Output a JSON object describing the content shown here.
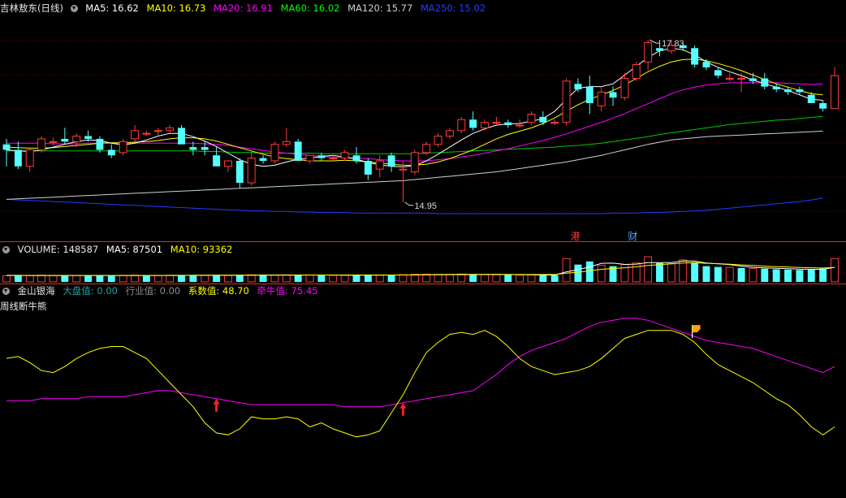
{
  "header": {
    "stock_name": "吉林敖东(日线)",
    "ma": [
      {
        "label": "MA5: 16.62",
        "color": "#ffffff"
      },
      {
        "label": "MA10: 16.73",
        "color": "#ffff00"
      },
      {
        "label": "MA20: 16.91",
        "color": "#ff00ff"
      },
      {
        "label": "MA60: 16.02",
        "color": "#00ff00"
      },
      {
        "label": "MA120: 15.77",
        "color": "#d0d0d0"
      },
      {
        "label": "MA250: 15.02",
        "color": "#1f3fff"
      }
    ]
  },
  "price_markers": {
    "high": "17.83",
    "low": "14.95",
    "tag1": "港",
    "tag2": "财"
  },
  "volume_legend": {
    "title": "VOLUME: 148587",
    "ma5": "MA5: 87501",
    "ma10": "MA10: 93362"
  },
  "indicator_legend": {
    "name": "金山银海",
    "dapan": "大盘值: 0.00",
    "hangye": "行业值: 0.00",
    "xishu": "系数值: 48.70",
    "qianniu": "牵牛值: 75.45",
    "subtitle": "周线断牛熊"
  },
  "colors": {
    "up": "#ff3b3b",
    "down": "#54ffff",
    "grid": "#7a0000",
    "separator": "#c0392b"
  },
  "chart_data": {
    "type": "candlestick",
    "ylim": [
      14.4,
      18.3
    ],
    "candles": [
      [
        16.0,
        16.1,
        15.6,
        15.9
      ],
      [
        15.9,
        16.05,
        15.55,
        15.6
      ],
      [
        15.6,
        15.95,
        15.5,
        15.9
      ],
      [
        15.9,
        16.15,
        15.85,
        16.1
      ],
      [
        16.05,
        16.12,
        15.98,
        16.05
      ],
      [
        16.1,
        16.3,
        16.0,
        16.05
      ],
      [
        16.05,
        16.2,
        15.95,
        16.15
      ],
      [
        16.15,
        16.25,
        16.05,
        16.1
      ],
      [
        16.1,
        16.15,
        15.85,
        15.9
      ],
      [
        15.9,
        16.0,
        15.75,
        15.8
      ],
      [
        15.85,
        16.1,
        15.8,
        16.05
      ],
      [
        16.1,
        16.35,
        16.05,
        16.25
      ],
      [
        16.2,
        16.25,
        16.15,
        16.2
      ],
      [
        16.25,
        16.3,
        16.15,
        16.25
      ],
      [
        16.25,
        16.35,
        16.2,
        16.3
      ],
      [
        16.3,
        16.35,
        16.0,
        16.0
      ],
      [
        15.95,
        16.05,
        15.8,
        15.9
      ],
      [
        15.95,
        16.05,
        15.8,
        15.9
      ],
      [
        15.8,
        15.95,
        15.6,
        15.6
      ],
      [
        15.6,
        15.7,
        15.5,
        15.7
      ],
      [
        15.7,
        15.75,
        15.2,
        15.3
      ],
      [
        15.3,
        15.9,
        15.25,
        15.75
      ],
      [
        15.75,
        15.8,
        15.65,
        15.7
      ],
      [
        15.7,
        16.05,
        15.65,
        16.0
      ],
      [
        16.0,
        16.3,
        15.95,
        16.05
      ],
      [
        16.05,
        16.1,
        15.7,
        15.7
      ],
      [
        15.7,
        15.8,
        15.65,
        15.8
      ],
      [
        15.8,
        15.85,
        15.7,
        15.75
      ],
      [
        15.75,
        15.8,
        15.7,
        15.75
      ],
      [
        15.75,
        15.9,
        15.7,
        15.85
      ],
      [
        15.8,
        15.95,
        15.65,
        15.7
      ],
      [
        15.7,
        15.75,
        15.35,
        15.45
      ],
      [
        15.55,
        15.8,
        15.4,
        15.7
      ],
      [
        15.8,
        15.85,
        15.5,
        15.6
      ],
      [
        15.55,
        15.7,
        14.95,
        15.55
      ],
      [
        15.5,
        15.9,
        15.45,
        15.85
      ],
      [
        15.85,
        16.05,
        15.8,
        16.0
      ],
      [
        16.0,
        16.2,
        15.95,
        16.15
      ],
      [
        16.15,
        16.3,
        16.1,
        16.25
      ],
      [
        16.25,
        16.5,
        16.2,
        16.45
      ],
      [
        16.45,
        16.6,
        16.25,
        16.3
      ],
      [
        16.3,
        16.45,
        16.25,
        16.4
      ],
      [
        16.4,
        16.5,
        16.35,
        16.4
      ],
      [
        16.4,
        16.45,
        16.3,
        16.35
      ],
      [
        16.35,
        16.45,
        16.3,
        16.35
      ],
      [
        16.4,
        16.6,
        16.35,
        16.55
      ],
      [
        16.5,
        16.6,
        16.35,
        16.4
      ],
      [
        16.4,
        16.45,
        16.35,
        16.4
      ],
      [
        16.4,
        17.2,
        16.35,
        17.15
      ],
      [
        17.1,
        17.2,
        16.95,
        17.0
      ],
      [
        17.05,
        17.25,
        16.55,
        16.75
      ],
      [
        16.7,
        17.05,
        16.6,
        16.95
      ],
      [
        16.95,
        17.05,
        16.7,
        16.85
      ],
      [
        16.85,
        17.3,
        16.8,
        17.2
      ],
      [
        17.2,
        17.5,
        17.15,
        17.45
      ],
      [
        17.5,
        17.9,
        17.35,
        17.85
      ],
      [
        17.75,
        17.9,
        17.6,
        17.7
      ],
      [
        17.7,
        17.9,
        17.65,
        17.8
      ],
      [
        17.8,
        17.83,
        17.7,
        17.75
      ],
      [
        17.75,
        17.8,
        17.4,
        17.45
      ],
      [
        17.5,
        17.55,
        17.35,
        17.4
      ],
      [
        17.35,
        17.4,
        17.2,
        17.25
      ],
      [
        17.2,
        17.3,
        17.15,
        17.2
      ],
      [
        17.2,
        17.3,
        16.95,
        17.2
      ],
      [
        17.2,
        17.3,
        17.1,
        17.15
      ],
      [
        17.2,
        17.3,
        17.0,
        17.05
      ],
      [
        17.05,
        17.1,
        16.95,
        17.0
      ],
      [
        17.0,
        17.05,
        16.9,
        16.95
      ],
      [
        17.0,
        17.05,
        16.9,
        16.95
      ],
      [
        16.9,
        16.95,
        16.75,
        16.75
      ],
      [
        16.75,
        16.8,
        16.6,
        16.65
      ],
      [
        16.65,
        17.4,
        16.7,
        17.25
      ]
    ],
    "ma5": [
      15.9,
      15.88,
      15.87,
      15.9,
      15.95,
      16.0,
      16.05,
      16.08,
      16.07,
      16.02,
      15.99,
      16.02,
      16.08,
      16.15,
      16.2,
      16.2,
      16.14,
      16.06,
      15.96,
      15.84,
      15.72,
      15.64,
      15.6,
      15.62,
      15.68,
      15.73,
      15.75,
      15.78,
      15.8,
      15.77,
      15.73,
      15.67,
      15.63,
      15.6,
      15.59,
      15.61,
      15.7,
      15.82,
      15.95,
      16.08,
      16.2,
      16.28,
      16.35,
      16.37,
      16.38,
      16.42,
      16.47,
      16.6,
      16.82,
      17.02,
      17.05,
      17.05,
      17.1,
      17.26,
      17.42,
      17.58,
      17.7,
      17.75,
      17.72,
      17.63,
      17.5,
      17.4,
      17.32,
      17.25,
      17.17,
      17.1,
      17.04,
      16.98,
      16.9,
      16.82,
      16.8
    ],
    "ma10": [
      15.95,
      15.94,
      15.93,
      15.93,
      15.94,
      15.96,
      15.98,
      16.0,
      16.02,
      16.03,
      16.03,
      16.04,
      16.05,
      16.07,
      16.1,
      16.12,
      16.12,
      16.1,
      16.06,
      16.0,
      15.94,
      15.88,
      15.82,
      15.77,
      15.74,
      15.72,
      15.7,
      15.7,
      15.7,
      15.71,
      15.7,
      15.68,
      15.66,
      15.64,
      15.62,
      15.62,
      15.64,
      15.68,
      15.74,
      15.82,
      15.9,
      16.0,
      16.1,
      16.18,
      16.24,
      16.3,
      16.38,
      16.48,
      16.6,
      16.72,
      16.82,
      16.9,
      16.98,
      17.08,
      17.2,
      17.32,
      17.42,
      17.5,
      17.54,
      17.55,
      17.52,
      17.47,
      17.41,
      17.34,
      17.26,
      17.18,
      17.1,
      17.04,
      16.98,
      16.92,
      16.9
    ],
    "ma20": [
      16.02,
      16.02,
      16.02,
      16.02,
      16.01,
      16.01,
      16.01,
      16.02,
      16.02,
      16.02,
      16.02,
      16.02,
      16.02,
      16.02,
      16.02,
      16.02,
      16.02,
      16.01,
      16.0,
      15.98,
      15.95,
      15.92,
      15.89,
      15.86,
      15.84,
      15.82,
      15.8,
      15.78,
      15.77,
      15.76,
      15.75,
      15.74,
      15.72,
      15.71,
      15.7,
      15.7,
      15.7,
      15.72,
      15.74,
      15.77,
      15.8,
      15.84,
      15.88,
      15.92,
      15.97,
      16.02,
      16.07,
      16.13,
      16.19,
      16.26,
      16.33,
      16.4,
      16.48,
      16.56,
      16.65,
      16.74,
      16.83,
      16.92,
      16.99,
      17.04,
      17.08,
      17.1,
      17.12,
      17.12,
      17.12,
      17.12,
      17.12,
      17.11,
      17.1,
      17.09,
      17.1
    ],
    "ma60": [
      15.88,
      15.88,
      15.88,
      15.88,
      15.88,
      15.88,
      15.88,
      15.88,
      15.88,
      15.88,
      15.88,
      15.88,
      15.88,
      15.88,
      15.88,
      15.88,
      15.88,
      15.87,
      15.87,
      15.86,
      15.85,
      15.85,
      15.84,
      15.84,
      15.84,
      15.84,
      15.84,
      15.83,
      15.83,
      15.83,
      15.83,
      15.83,
      15.83,
      15.83,
      15.83,
      15.83,
      15.84,
      15.85,
      15.86,
      15.87,
      15.88,
      15.89,
      15.9,
      15.91,
      15.92,
      15.93,
      15.94,
      15.95,
      15.97,
      15.98,
      16.0,
      16.02,
      16.05,
      16.08,
      16.11,
      16.14,
      16.18,
      16.21,
      16.24,
      16.27,
      16.3,
      16.33,
      16.36,
      16.38,
      16.4,
      16.42,
      16.44,
      16.45,
      16.47,
      16.49,
      16.51
    ],
    "ma120": [
      15.0,
      15.01,
      15.02,
      15.03,
      15.04,
      15.05,
      15.06,
      15.07,
      15.08,
      15.09,
      15.1,
      15.11,
      15.12,
      15.13,
      15.14,
      15.15,
      15.16,
      15.17,
      15.18,
      15.19,
      15.2,
      15.21,
      15.22,
      15.23,
      15.24,
      15.25,
      15.26,
      15.27,
      15.28,
      15.29,
      15.3,
      15.31,
      15.32,
      15.33,
      15.34,
      15.36,
      15.38,
      15.4,
      15.42,
      15.44,
      15.46,
      15.48,
      15.5,
      15.53,
      15.56,
      15.59,
      15.62,
      15.65,
      15.68,
      15.72,
      15.76,
      15.8,
      15.85,
      15.9,
      15.95,
      16.0,
      16.04,
      16.08,
      16.1,
      16.12,
      16.14,
      16.15,
      16.16,
      16.17,
      16.18,
      16.19,
      16.2,
      16.21,
      16.22,
      16.23,
      16.24
    ],
    "ma250": [
      15.0,
      14.99,
      14.98,
      14.97,
      14.96,
      14.95,
      14.94,
      14.93,
      14.92,
      14.91,
      14.9,
      14.89,
      14.88,
      14.87,
      14.86,
      14.85,
      14.84,
      14.83,
      14.82,
      14.81,
      14.8,
      14.79,
      14.79,
      14.78,
      14.78,
      14.77,
      14.77,
      14.76,
      14.76,
      14.76,
      14.75,
      14.75,
      14.75,
      14.75,
      14.75,
      14.75,
      14.75,
      14.74,
      14.74,
      14.74,
      14.74,
      14.74,
      14.74,
      14.74,
      14.74,
      14.74,
      14.74,
      14.74,
      14.74,
      14.74,
      14.74,
      14.74,
      14.75,
      14.75,
      14.75,
      14.76,
      14.76,
      14.77,
      14.78,
      14.79,
      14.8,
      14.82,
      14.84,
      14.86,
      14.88,
      14.9,
      14.92,
      14.94,
      14.96,
      14.99,
      15.02
    ],
    "volume": [
      [
        40,
        1
      ],
      [
        42,
        0
      ],
      [
        40,
        1
      ],
      [
        43,
        1
      ],
      [
        40,
        1
      ],
      [
        42,
        0
      ],
      [
        41,
        1
      ],
      [
        40,
        0
      ],
      [
        42,
        0
      ],
      [
        40,
        0
      ],
      [
        41,
        1
      ],
      [
        43,
        1
      ],
      [
        40,
        0
      ],
      [
        41,
        1
      ],
      [
        42,
        1
      ],
      [
        44,
        0
      ],
      [
        43,
        0
      ],
      [
        42,
        1
      ],
      [
        43,
        0
      ],
      [
        41,
        1
      ],
      [
        44,
        0
      ],
      [
        45,
        1
      ],
      [
        43,
        0
      ],
      [
        44,
        1
      ],
      [
        45,
        1
      ],
      [
        46,
        0
      ],
      [
        43,
        1
      ],
      [
        42,
        0
      ],
      [
        41,
        1
      ],
      [
        42,
        1
      ],
      [
        43,
        0
      ],
      [
        45,
        0
      ],
      [
        44,
        1
      ],
      [
        43,
        0
      ],
      [
        46,
        1
      ],
      [
        48,
        1
      ],
      [
        49,
        1
      ],
      [
        47,
        1
      ],
      [
        48,
        1
      ],
      [
        50,
        1
      ],
      [
        49,
        0
      ],
      [
        46,
        1
      ],
      [
        45,
        1
      ],
      [
        44,
        0
      ],
      [
        43,
        1
      ],
      [
        45,
        1
      ],
      [
        44,
        0
      ],
      [
        43,
        0
      ],
      [
        148,
        1
      ],
      [
        110,
        0
      ],
      [
        130,
        0
      ],
      [
        105,
        1
      ],
      [
        100,
        0
      ],
      [
        110,
        1
      ],
      [
        120,
        1
      ],
      [
        160,
        1
      ],
      [
        120,
        0
      ],
      [
        115,
        1
      ],
      [
        140,
        1
      ],
      [
        125,
        0
      ],
      [
        100,
        0
      ],
      [
        95,
        0
      ],
      [
        92,
        1
      ],
      [
        88,
        0
      ],
      [
        86,
        1
      ],
      [
        84,
        0
      ],
      [
        80,
        0
      ],
      [
        78,
        0
      ],
      [
        76,
        0
      ],
      [
        78,
        0
      ],
      [
        85,
        0
      ],
      [
        148,
        1
      ]
    ],
    "vol_ma5": [
      42,
      42,
      41,
      41,
      41,
      41,
      41,
      41,
      41,
      41,
      41,
      41,
      41,
      41,
      42,
      42,
      42,
      43,
      43,
      43,
      43,
      43,
      44,
      44,
      44,
      44,
      44,
      44,
      44,
      43,
      43,
      43,
      43,
      44,
      44,
      45,
      46,
      47,
      47,
      48,
      48,
      48,
      48,
      47,
      46,
      45,
      44,
      44,
      64,
      78,
      95,
      118,
      119,
      111,
      113,
      123,
      123,
      123,
      133,
      132,
      120,
      115,
      110,
      100,
      93,
      89,
      86,
      84,
      81,
      80,
      80,
      93
    ],
    "vol_ma10": [
      41,
      41,
      41,
      41,
      41,
      41,
      41,
      41,
      41,
      41,
      41,
      41,
      41,
      41,
      41,
      41,
      42,
      42,
      42,
      42,
      43,
      43,
      43,
      43,
      43,
      43,
      44,
      44,
      44,
      44,
      44,
      44,
      44,
      44,
      44,
      44,
      45,
      45,
      46,
      46,
      46,
      47,
      47,
      47,
      47,
      47,
      47,
      47,
      55,
      62,
      70,
      80,
      85,
      90,
      96,
      105,
      110,
      115,
      120,
      122,
      118,
      116,
      112,
      108,
      104,
      100,
      97,
      95,
      92,
      90,
      88,
      92
    ],
    "vol_ylim": [
      0,
      160
    ],
    "indicator": {
      "yellow": [
        52,
        53,
        50,
        46,
        45,
        48,
        52,
        55,
        57,
        58,
        58,
        55,
        52,
        46,
        40,
        34,
        28,
        20,
        15,
        14,
        17,
        23,
        22,
        22,
        23,
        22,
        18,
        20,
        17,
        15,
        13,
        14,
        16,
        25,
        34,
        45,
        55,
        60,
        64,
        65,
        64,
        66,
        63,
        58,
        52,
        48,
        46,
        44,
        45,
        46,
        48,
        52,
        57,
        62,
        64,
        66,
        66,
        66,
        64,
        60,
        54,
        49,
        46,
        43,
        40,
        36,
        32,
        29,
        24,
        18,
        14,
        18
      ],
      "magenta": [
        31,
        31,
        31,
        32,
        32,
        32,
        32,
        33,
        33,
        33,
        33,
        34,
        35,
        36,
        36,
        35,
        34,
        33,
        32,
        31,
        30,
        29,
        29,
        29,
        29,
        29,
        29,
        29,
        29,
        28,
        28,
        28,
        28,
        29,
        30,
        31,
        32,
        33,
        34,
        35,
        36,
        40,
        44,
        49,
        53,
        56,
        58,
        60,
        62,
        65,
        68,
        70,
        71,
        72,
        72,
        71,
        69,
        67,
        65,
        63,
        61,
        60,
        59,
        58,
        57,
        55,
        53,
        51,
        49,
        47,
        45,
        48
      ],
      "ylim": [
        0,
        80
      ],
      "up_arrows": [
        18,
        34
      ],
      "flag_index": 59
    }
  }
}
